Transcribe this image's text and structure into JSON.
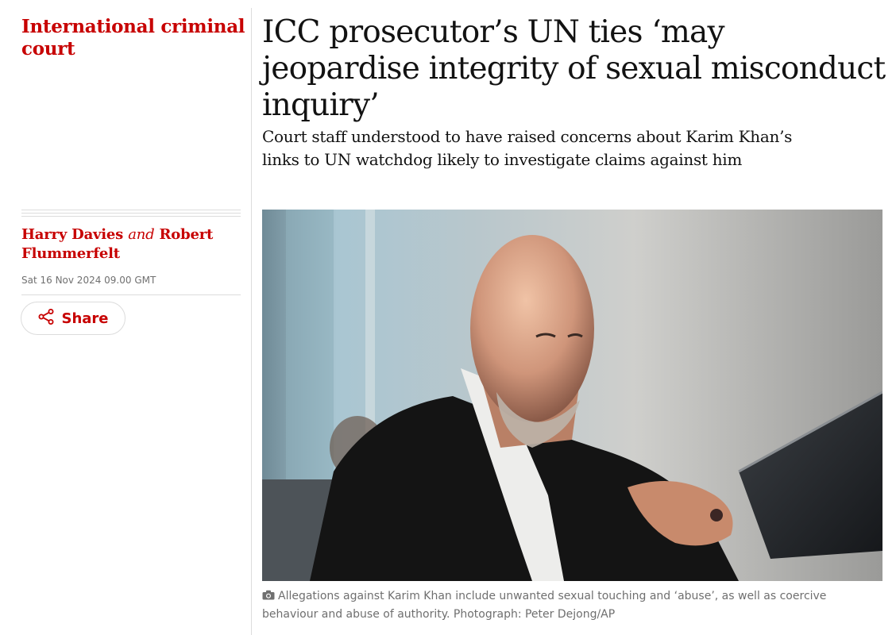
{
  "section": {
    "label": "International criminal court"
  },
  "article": {
    "headline": "ICC prosecutor’s UN ties ‘may jeopardise integrity of sexual misconduct inquiry’",
    "standfirst": "Court staff understood to have raised concerns about Karim Khan’s links to UN watchdog likely to investigate claims against him",
    "byline": {
      "author1": "Harry Davies",
      "conjunction": "and",
      "author2": "Robert Flummerfelt"
    },
    "dateline": "Sat 16 Nov 2024 09.00 GMT",
    "share_label": "Share",
    "caption": "Allegations against Karim Khan include unwanted sexual touching and ‘abuse’, as well as coercive behaviour and abuse of authority. Photograph: Peter Dejong/AP"
  },
  "icons": {
    "share": "share-icon",
    "camera": "camera-icon"
  },
  "colors": {
    "accent": "#c70000",
    "text": "#121212",
    "muted": "#707070",
    "rule": "#dcdcdc"
  }
}
